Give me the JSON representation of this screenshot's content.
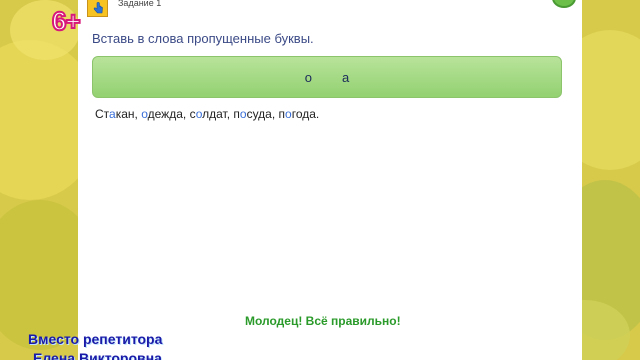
{
  "header": {
    "age_badge": "6+",
    "task_label": "Задание 1",
    "task_icon": "hand-pointer-icon"
  },
  "exercise": {
    "instruction": "Вставь в слова пропущенные буквы.",
    "letters": [
      "о",
      "а"
    ],
    "words": [
      {
        "before": "Ст",
        "ins": "а",
        "after": "кан"
      },
      {
        "before": "",
        "ins": "о",
        "after": "дежда"
      },
      {
        "before": "с",
        "ins": "о",
        "after": "лдат"
      },
      {
        "before": "п",
        "ins": "о",
        "after": "суда"
      },
      {
        "before": "п",
        "ins": "о",
        "after": "года"
      }
    ],
    "punct": [
      ", ",
      ", ",
      ", ",
      ", ",
      "."
    ]
  },
  "feedback": {
    "message": "Молодец! Всё правильно!"
  },
  "watermark": {
    "line1": "Вместо репетитора",
    "line2": "Елена Викторовна"
  },
  "colors": {
    "background": "#d7c94a",
    "bar_fill": "#93d171",
    "inserted_letter": "#3a6fd8",
    "success_text": "#2a9a2a",
    "badge_outline": "#d7187a"
  }
}
